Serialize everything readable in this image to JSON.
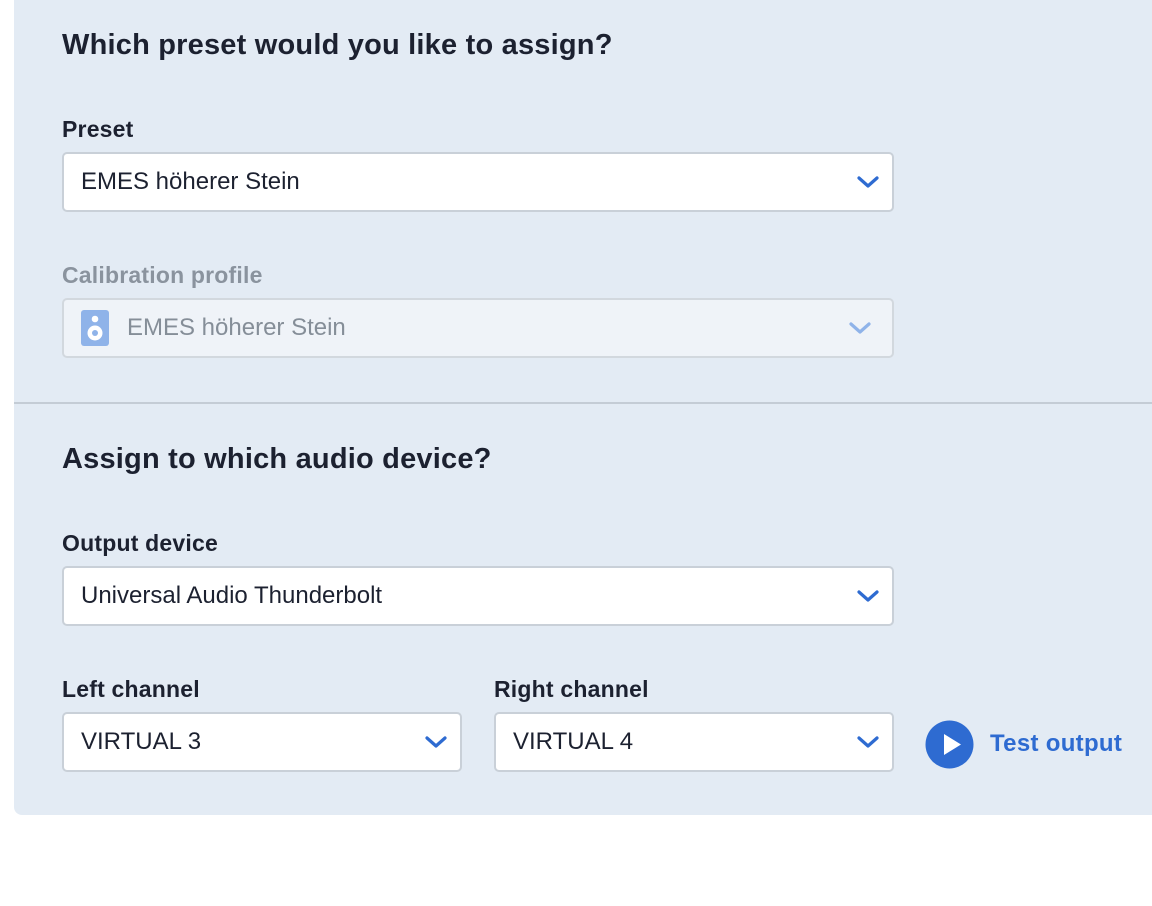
{
  "preset_section": {
    "title": "Which preset would you like to assign?",
    "preset_label": "Preset",
    "preset_value": "EMES höherer Stein",
    "calibration_label": "Calibration profile",
    "calibration_value": "EMES höherer Stein",
    "calibration_disabled": true
  },
  "device_section": {
    "title": "Assign to which audio device?",
    "output_label": "Output device",
    "output_value": "Universal Audio Thunderbolt",
    "left_label": "Left channel",
    "left_value": "VIRTUAL 3",
    "right_label": "Right channel",
    "right_value": "VIRTUAL 4",
    "test_label": "Test output"
  },
  "icons": {
    "dropdown": "chevron-down-icon",
    "calibration": "speaker-icon",
    "test": "play-icon"
  },
  "colors": {
    "accent": "#2e6bd1",
    "panel_background": "#e3ebf4",
    "text": "#1c2130",
    "disabled_text": "#858e98"
  }
}
